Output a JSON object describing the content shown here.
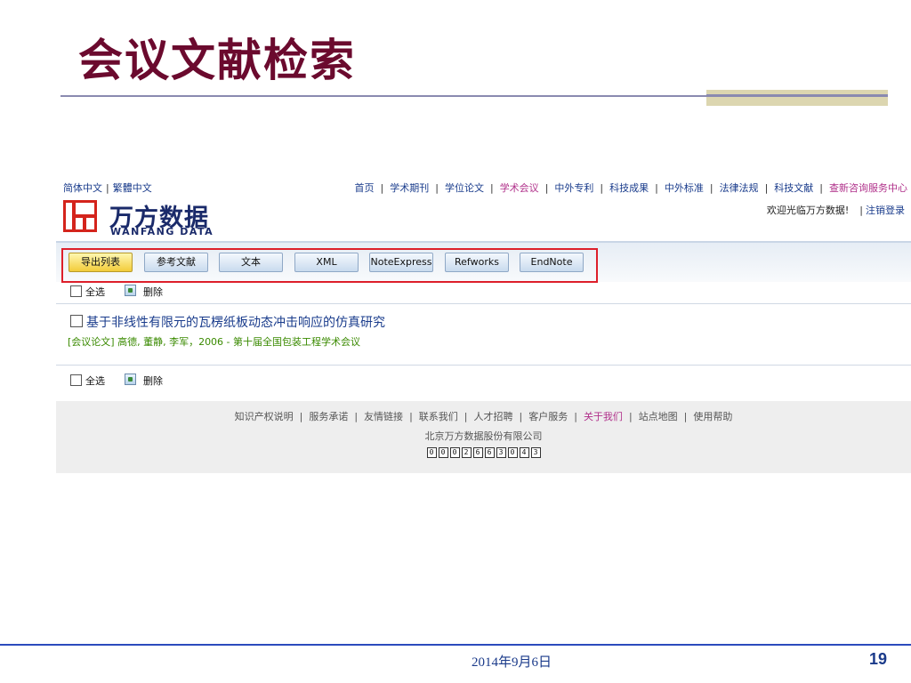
{
  "slide": {
    "title": "会议文献检索",
    "date": "2014年9月6日",
    "page_number": "19"
  },
  "site": {
    "lang_simplified": "简体中文",
    "lang_separator": "|",
    "lang_traditional": "繁體中文",
    "logo_cn": "万方数据",
    "logo_en": "WANFANG DATA",
    "nav_items": [
      {
        "label": "首页"
      },
      {
        "label": "学术期刊"
      },
      {
        "label": "学位论文"
      },
      {
        "label": "学术会议"
      },
      {
        "label": "中外专利"
      },
      {
        "label": "科技成果"
      },
      {
        "label": "中外标准"
      },
      {
        "label": "法律法规"
      },
      {
        "label": "科技文献"
      },
      {
        "label": "查新咨询服务中心"
      }
    ],
    "welcome_text": "欢迎光临万方数据!",
    "logout_label": "注销登录"
  },
  "toolbar": {
    "buttons": [
      {
        "label": "导出列表"
      },
      {
        "label": "参考文献"
      },
      {
        "label": "文本"
      },
      {
        "label": "XML"
      },
      {
        "label": "NoteExpress"
      },
      {
        "label": "Refworks"
      },
      {
        "label": "EndNote"
      }
    ]
  },
  "selection": {
    "select_all_label": "全选",
    "delete_label": "删除"
  },
  "result": {
    "title": "基于非线性有限元的瓦楞纸板动态冲击响应的仿真研究",
    "meta": "[会议论文] 高德, 董静, 李军，2006 - 第十届全国包装工程学术会议"
  },
  "footer": {
    "links": [
      {
        "label": "知识产权说明"
      },
      {
        "label": "服务承诺"
      },
      {
        "label": "友情链接"
      },
      {
        "label": "联系我们"
      },
      {
        "label": "人才招聘"
      },
      {
        "label": "客户服务"
      },
      {
        "label": "关于我们"
      },
      {
        "label": "站点地图"
      },
      {
        "label": "使用帮助"
      }
    ],
    "company": "北京万方数据股份有限公司",
    "counter_digits": [
      "0",
      "0",
      "0",
      "2",
      "6",
      "6",
      "3",
      "0",
      "4",
      "3"
    ]
  },
  "colors": {
    "title": "#6b0a2e",
    "link": "#1a3c8c",
    "active_link": "#b0308a",
    "meta_green": "#3a8a00",
    "highlight_frame": "#dd1f2a"
  }
}
